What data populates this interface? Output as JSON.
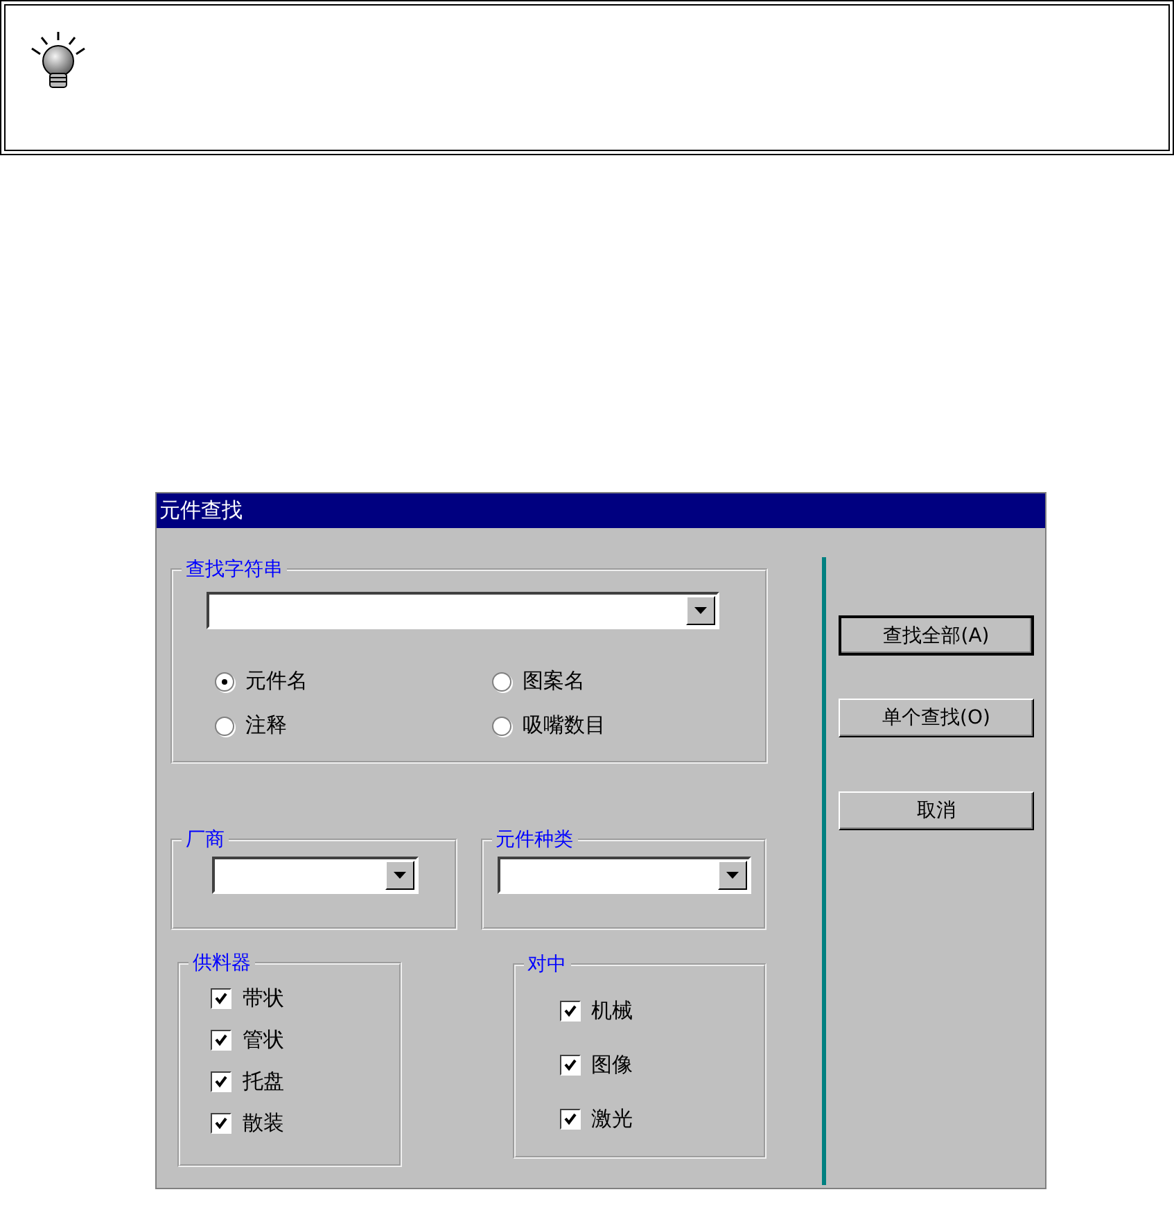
{
  "dialog": {
    "title": "元件查找",
    "search_group": {
      "title": "查找字符串",
      "options": [
        {
          "label": "元件名",
          "selected": true
        },
        {
          "label": "图案名",
          "selected": false
        },
        {
          "label": "注释",
          "selected": false
        },
        {
          "label": "吸嘴数目",
          "selected": false
        }
      ]
    },
    "vendor_group": {
      "title": "厂商"
    },
    "type_group": {
      "title": "元件种类"
    },
    "feeder_group": {
      "title": "供料器",
      "items": [
        {
          "label": "带状",
          "checked": true
        },
        {
          "label": "管状",
          "checked": true
        },
        {
          "label": "托盘",
          "checked": true
        },
        {
          "label": "散装",
          "checked": true
        }
      ]
    },
    "centering_group": {
      "title": "对中",
      "items": [
        {
          "label": "机械",
          "checked": true
        },
        {
          "label": "图像",
          "checked": true
        },
        {
          "label": "激光",
          "checked": true
        }
      ]
    },
    "buttons": [
      {
        "label": "查找全部(A)",
        "default": true
      },
      {
        "label": "单个查找(O)",
        "default": false
      },
      {
        "label": "取消",
        "default": false
      }
    ]
  }
}
